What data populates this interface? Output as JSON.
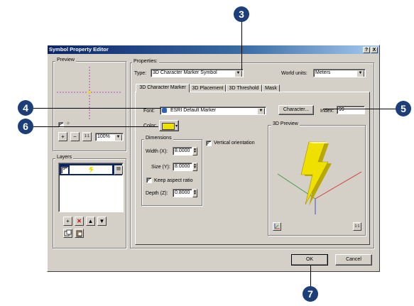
{
  "dialog": {
    "title": "Symbol Property Editor",
    "help_btn": "?",
    "close_btn": "X"
  },
  "preview": {
    "group_label": "Preview",
    "check_mark": "✓",
    "plus_glyph": "+",
    "zoom_in_glyph": "+",
    "zoom_out_glyph": "−",
    "actual_size_glyph": "1:1",
    "zoom_value": "100%"
  },
  "layers": {
    "group_label": "Layers",
    "check_mark": "✓",
    "add_glyph": "+",
    "delete_glyph": "✕",
    "up_glyph": "▲",
    "down_glyph": "▼"
  },
  "properties": {
    "group_label": "Properties:",
    "type_label": "Type:",
    "type_value": "3D Character Marker Symbol",
    "world_units_label": "World units:",
    "world_units_value": "Meters"
  },
  "tabs": [
    {
      "label": "3D Character Marker"
    },
    {
      "label": "3D Placement"
    },
    {
      "label": "3D Threshold"
    },
    {
      "label": "Mask"
    }
  ],
  "character_tab": {
    "font_label": "Font:",
    "font_value": "ESRI Default Marker",
    "character_button": "Character...",
    "index_label": "Index:",
    "index_value": "99",
    "color_label": "Color:",
    "dimensions_label": "Dimensions",
    "width_label": "Width (X):",
    "width_value": "8.0000",
    "size_label": "Size (Y):",
    "size_value": "8.0000",
    "keep_aspect_label": "Keep aspect ratio",
    "depth_label": "Depth (Z):",
    "depth_value": "0.8000",
    "vertical_label": "Vertical orientation",
    "check_mark": "✓",
    "preview_label": "3D Preview"
  },
  "footer": {
    "ok_label": "OK",
    "cancel_label": "Cancel"
  },
  "callouts": [
    "3",
    "4",
    "5",
    "6",
    "7"
  ],
  "colors": {
    "callout": "#1c3f7a",
    "symbol_color": "#f0e000",
    "titlebar_start": "#0a246a",
    "titlebar_end": "#a6caf0"
  }
}
